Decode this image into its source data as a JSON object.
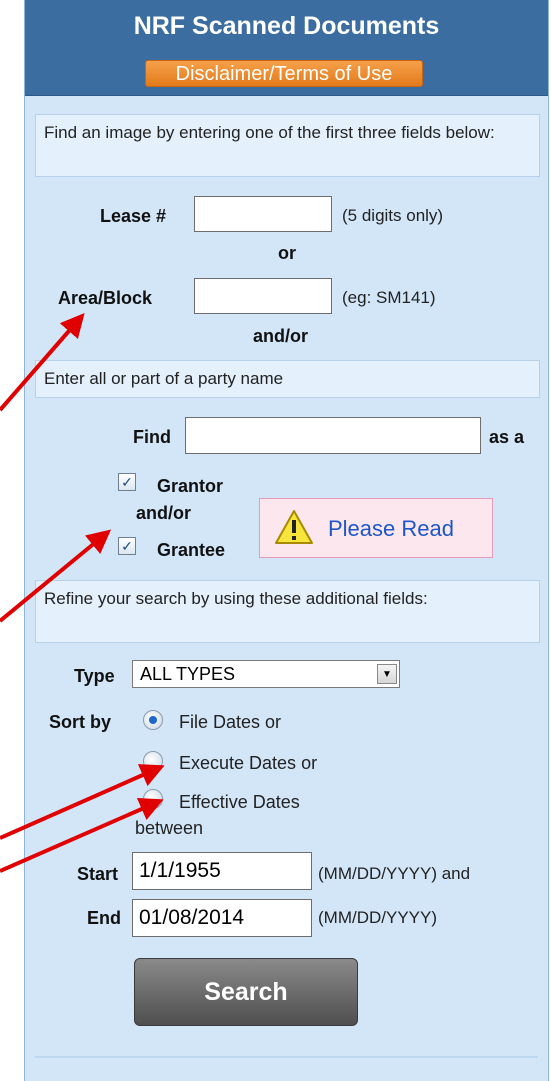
{
  "header": {
    "title": "NRF Scanned Documents",
    "disclaimer_label": "Disclaimer/Terms of Use"
  },
  "intro_text": "Find an image by entering one of the first three fields below:",
  "lease": {
    "label": "Lease #",
    "value": "",
    "hint": "(5 digits only)"
  },
  "or_label": "or",
  "area_block": {
    "label": "Area/Block",
    "value": "",
    "hint": "(eg: SM141)"
  },
  "and_or_label": "and/or",
  "party_text": "Enter all or part of a party name",
  "find": {
    "label": "Find",
    "value": "",
    "suffix": "as a"
  },
  "grantor": {
    "label": "Grantor",
    "checked": true
  },
  "grantor_grantee_joiner": "and/or",
  "grantee": {
    "label": "Grantee",
    "checked": true
  },
  "please_read": {
    "label": "Please Read",
    "icon": "warning-icon"
  },
  "refine_text": "Refine your search by using these additional fields:",
  "type": {
    "label": "Type",
    "selected": "ALL TYPES"
  },
  "sort_by": {
    "label": "Sort by",
    "options": [
      "File Dates or",
      "Execute Dates or",
      "Effective Dates"
    ],
    "selected_index": 0
  },
  "between_label": "between",
  "start": {
    "label": "Start",
    "value": "1/1/1955",
    "hint": "(MM/DD/YYYY) and"
  },
  "end": {
    "label": "End",
    "value": "01/08/2014",
    "hint": "(MM/DD/YYYY)"
  },
  "search_button_label": "Search",
  "colors": {
    "panel_background": "#d3e6f8",
    "header_background": "#3b6da0",
    "disclaimer_orange": "#e37b1c",
    "annotation_arrow_red": "#e00000"
  }
}
